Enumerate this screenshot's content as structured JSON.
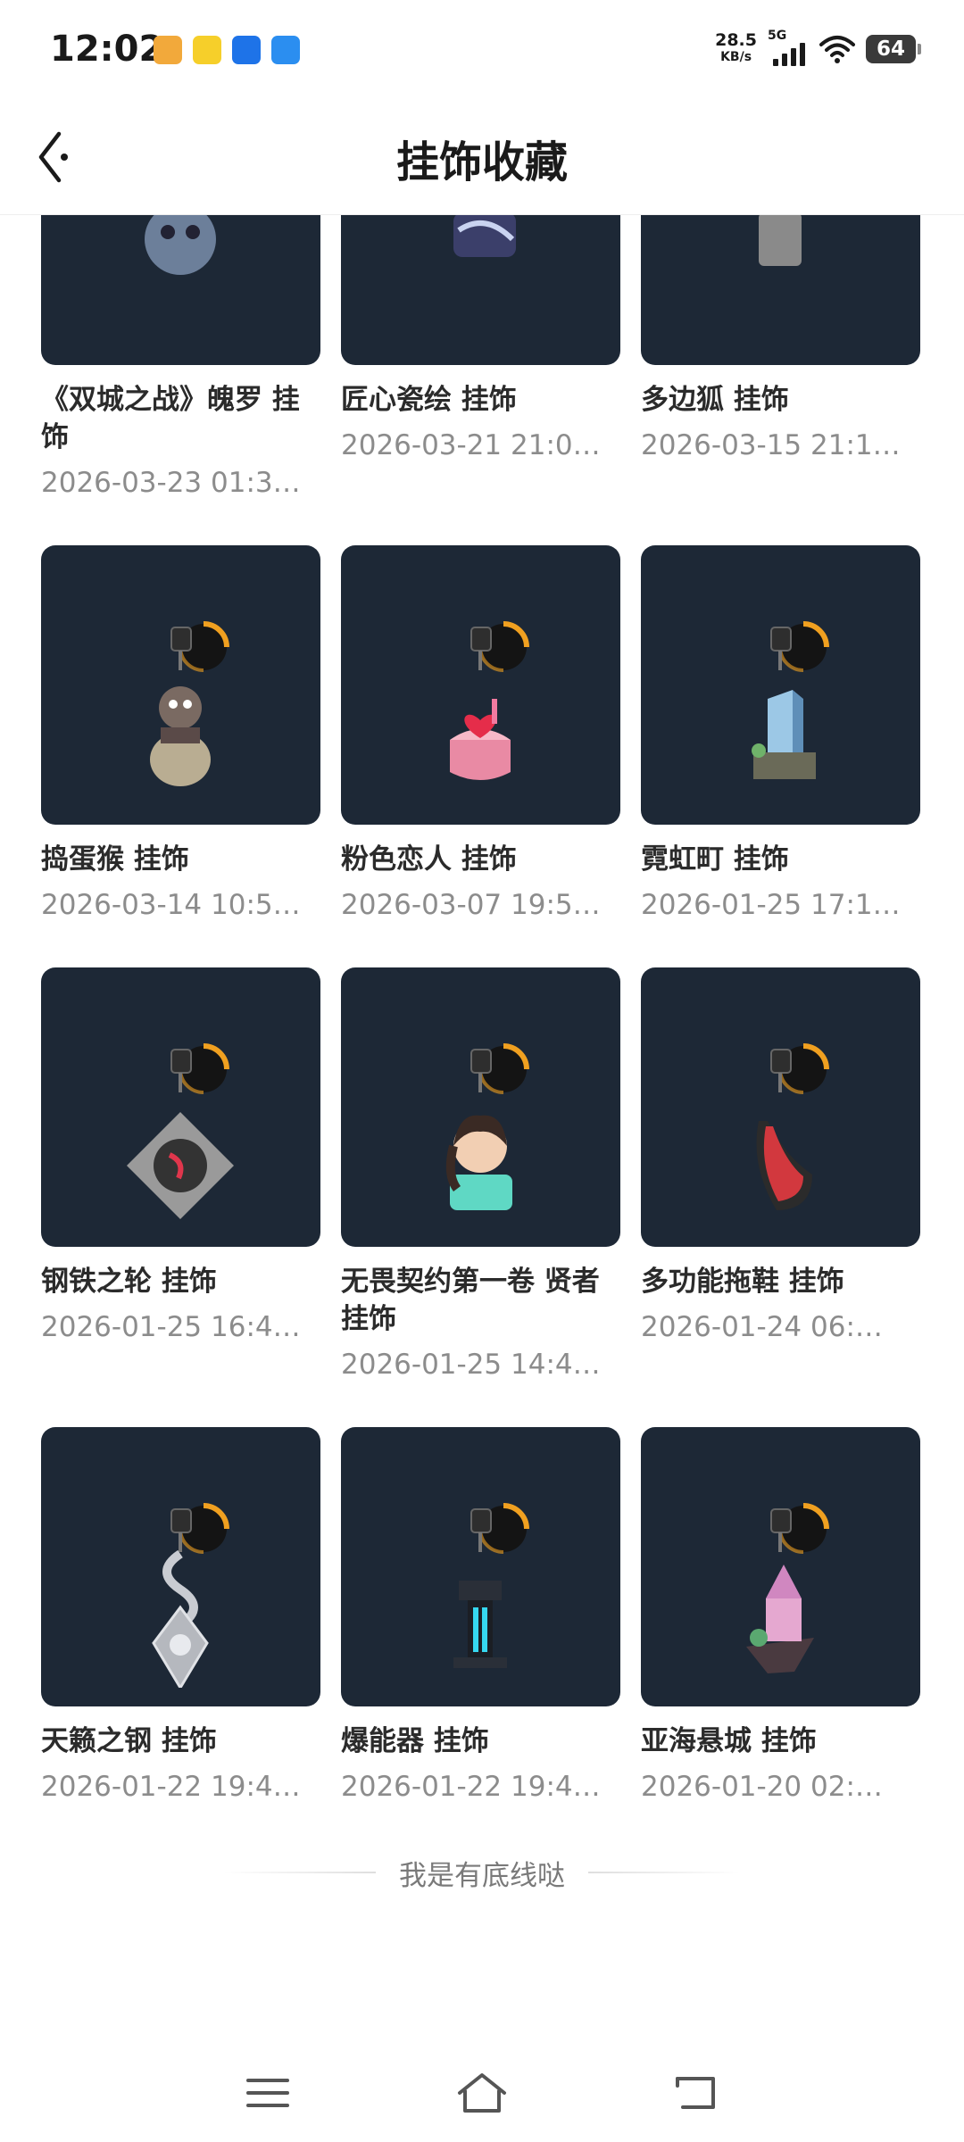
{
  "status_bar": {
    "time": "12:02",
    "net_speed_value": "28.5",
    "net_speed_unit": "KB/s",
    "network_type": "5G",
    "battery": "64"
  },
  "header": {
    "title": "挂饰收藏"
  },
  "items": [
    {
      "name": "《双城之战》魄罗 挂饰",
      "date": "2026-03-23 01:3…",
      "icon": "poro-charm-icon"
    },
    {
      "name": "匠心瓷绘 挂饰",
      "date": "2026-03-21 21:0…",
      "icon": "porcelain-charm-icon"
    },
    {
      "name": "多边狐 挂饰",
      "date": "2026-03-15 21:1…",
      "icon": "polygon-fox-charm-icon"
    },
    {
      "name": "捣蛋猴 挂饰",
      "date": "2026-03-14 10:5…",
      "icon": "mischief-monkey-charm-icon"
    },
    {
      "name": "粉色恋人 挂饰",
      "date": "2026-03-07 19:5…",
      "icon": "pink-heart-cake-charm-icon"
    },
    {
      "name": "霓虹町 挂饰",
      "date": "2026-01-25 17:1…",
      "icon": "neon-city-tower-charm-icon"
    },
    {
      "name": "钢铁之轮 挂饰",
      "date": "2026-01-25 16:4…",
      "icon": "steel-wheel-turntable-charm-icon"
    },
    {
      "name": "无畏契约第一卷 贤者 挂饰",
      "date": "2026-01-25 14:4…",
      "icon": "sage-figure-charm-icon"
    },
    {
      "name": "多功能拖鞋 挂饰",
      "date": "2026-01-24 06:…",
      "icon": "flip-flop-charm-icon"
    },
    {
      "name": "天籁之钢 挂饰",
      "date": "2026-01-22 19:4…",
      "icon": "steel-blade-ornament-charm-icon"
    },
    {
      "name": "爆能器 挂饰",
      "date": "2026-01-22 19:4…",
      "icon": "blaster-device-charm-icon"
    },
    {
      "name": "亚海悬城 挂饰",
      "date": "2026-01-20 02:…",
      "icon": "floating-castle-island-charm-icon"
    }
  ],
  "footer": {
    "end_text": "我是有底线哒"
  },
  "nav": {
    "menu_icon": "menu-icon",
    "home_icon": "home-icon",
    "back_icon": "back-icon"
  },
  "colors": {
    "card_bg": "#1d2836",
    "ring_orange": "#f0a020"
  }
}
